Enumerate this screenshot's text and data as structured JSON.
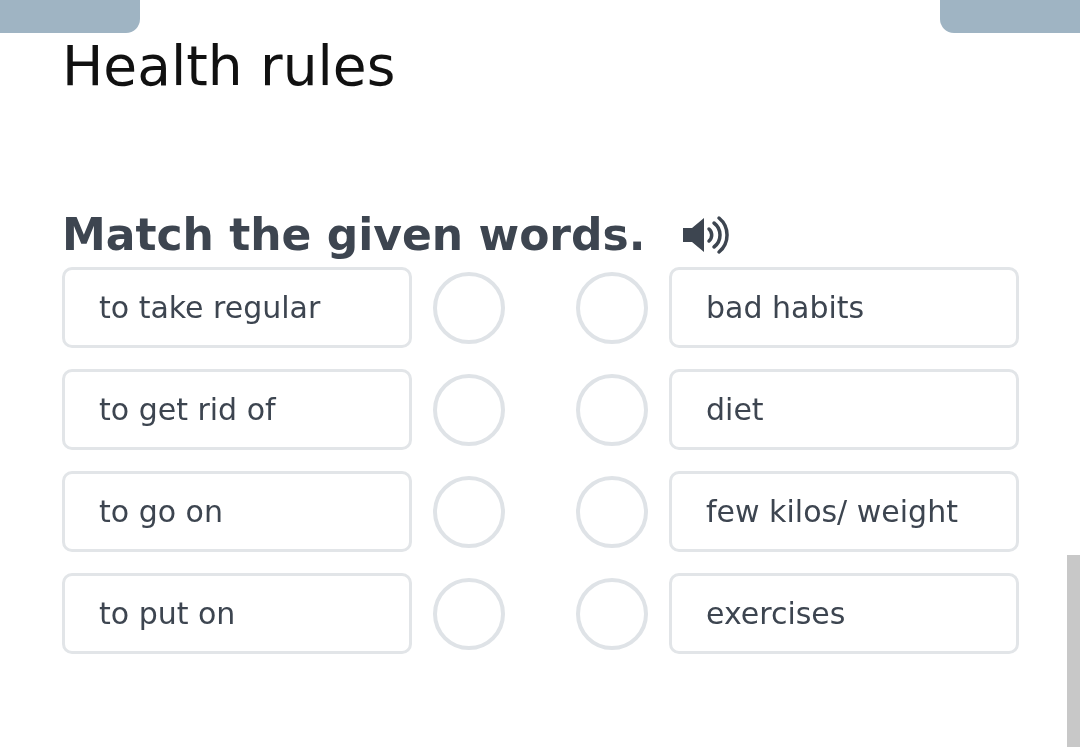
{
  "title": "Health rules",
  "instruction": "Match the given words.",
  "rows": [
    {
      "left": "to take regular",
      "right": "bad habits"
    },
    {
      "left": "to get rid of",
      "right": "diet"
    },
    {
      "left": "to go on",
      "right": "few kilos/ weight"
    },
    {
      "left": "to put on",
      "right": "exercises"
    }
  ]
}
